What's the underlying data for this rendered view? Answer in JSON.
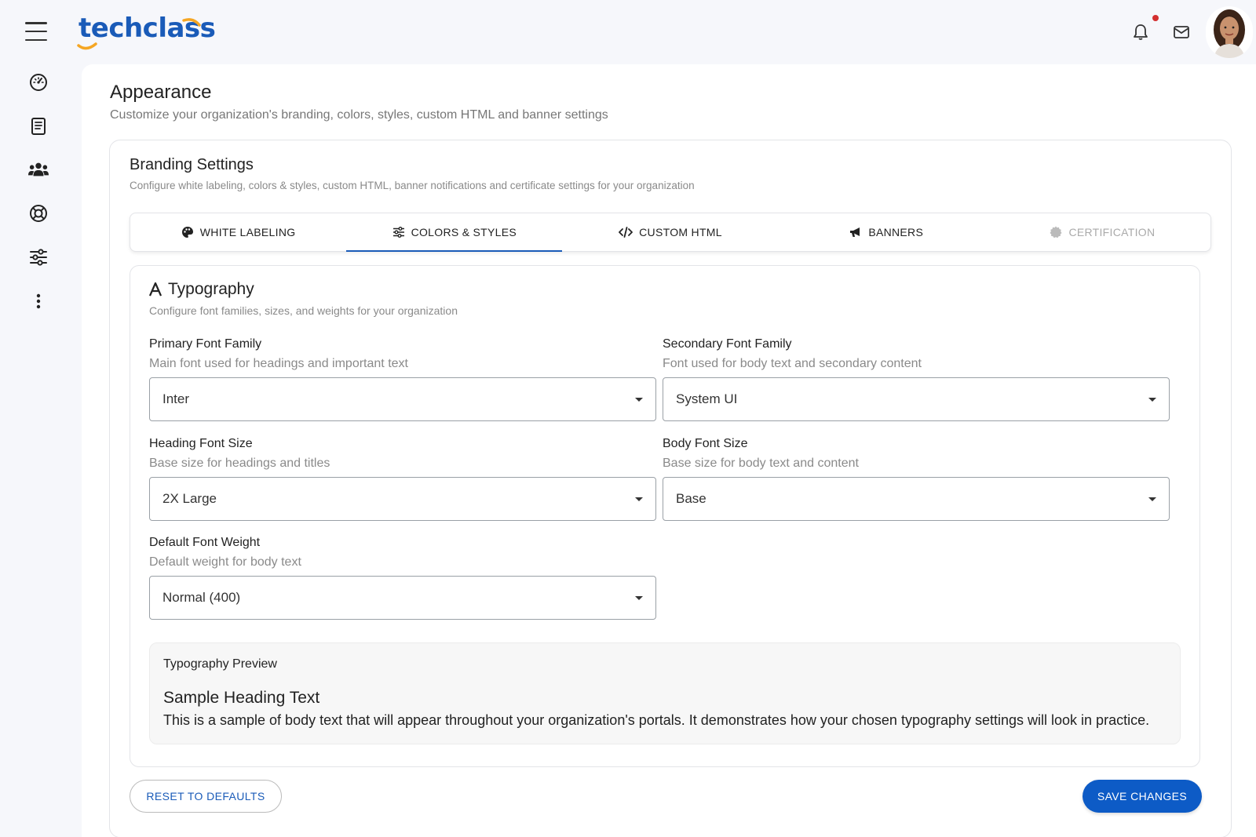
{
  "header": {
    "logo_text": "techclass",
    "brand_color": "#1a5bb8",
    "logo_accent_color": "#f5a623",
    "notification_dot_color": "#d32f2f",
    "icons": [
      "menu-icon",
      "bell-icon",
      "mail-icon",
      "avatar"
    ]
  },
  "sidebar": {
    "icons": [
      "dashboard-icon",
      "book-icon",
      "users-icon",
      "support-icon",
      "sliders-icon",
      "more-vertical-icon"
    ]
  },
  "page": {
    "title": "Appearance",
    "subtitle": "Customize your organization's branding, colors, styles, custom HTML and banner settings"
  },
  "branding": {
    "title": "Branding Settings",
    "subtitle": "Configure white labeling, colors & styles, custom HTML, banner notifications and certificate settings for your organization"
  },
  "tabs": [
    {
      "label": "WHITE LABELING",
      "icon": "palette-icon",
      "active": false,
      "disabled": false
    },
    {
      "label": "COLORS & STYLES",
      "icon": "sliders-icon",
      "active": true,
      "disabled": false
    },
    {
      "label": "CUSTOM HTML",
      "icon": "code-icon",
      "active": false,
      "disabled": false
    },
    {
      "label": "BANNERS",
      "icon": "megaphone-icon",
      "active": false,
      "disabled": false
    },
    {
      "label": "CERTIFICATION",
      "icon": "badge-icon",
      "active": false,
      "disabled": true
    }
  ],
  "typography": {
    "title": "Typography",
    "subtitle": "Configure font families, sizes, and weights for your organization",
    "primary_font": {
      "label": "Primary Font Family",
      "help": "Main font used for headings and important text",
      "value": "Inter"
    },
    "secondary_font": {
      "label": "Secondary Font Family",
      "help": "Font used for body text and secondary content",
      "value": "System UI"
    },
    "heading_size": {
      "label": "Heading Font Size",
      "help": "Base size for headings and titles",
      "value": "2X Large"
    },
    "body_size": {
      "label": "Body Font Size",
      "help": "Base size for body text and content",
      "value": "Base"
    },
    "font_weight": {
      "label": "Default Font Weight",
      "help": "Default weight for body text",
      "value": "Normal (400)"
    },
    "preview": {
      "label": "Typography Preview",
      "heading": "Sample Heading Text",
      "body": "This is a sample of body text that will appear throughout your organization's portals. It demonstrates how your chosen typography settings will look in practice."
    }
  },
  "actions": {
    "reset_label": "RESET TO DEFAULTS",
    "save_label": "SAVE CHANGES",
    "primary_color": "#0d5bc6"
  }
}
